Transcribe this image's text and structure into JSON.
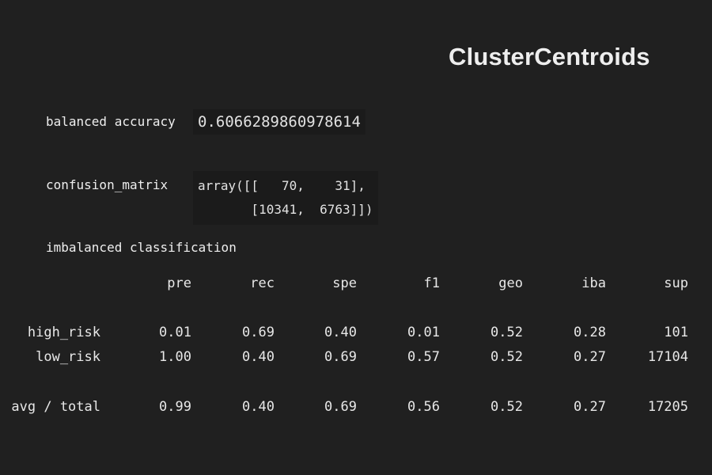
{
  "title": "ClusterCentroids",
  "balanced_accuracy": {
    "label": "balanced accuracy",
    "value": "0.6066289860978614"
  },
  "confusion_matrix": {
    "label": "confusion_matrix",
    "line1": "array([[   70,    31],",
    "line2": "       [10341,  6763]])"
  },
  "report": {
    "heading": "imbalanced classification",
    "columns": [
      "pre",
      "rec",
      "spe",
      "f1",
      "geo",
      "iba",
      "sup"
    ],
    "rows": [
      {
        "label": "high_risk",
        "values": [
          "0.01",
          "0.69",
          "0.40",
          "0.01",
          "0.52",
          "0.28",
          "101"
        ]
      },
      {
        "label": "low_risk",
        "values": [
          "1.00",
          "0.40",
          "0.69",
          "0.57",
          "0.52",
          "0.27",
          "17104"
        ]
      },
      {
        "label": "avg / total",
        "values": [
          "0.99",
          "0.40",
          "0.69",
          "0.56",
          "0.52",
          "0.27",
          "17205"
        ]
      }
    ]
  }
}
